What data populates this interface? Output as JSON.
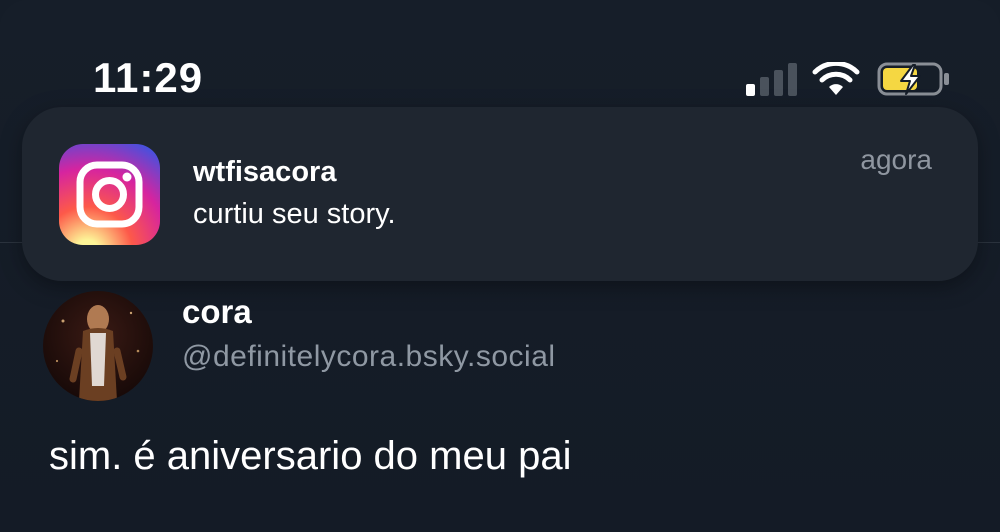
{
  "status_bar": {
    "time": "11:29",
    "icons": [
      "cellular-signal-icon",
      "wifi-icon",
      "battery-charging-icon"
    ],
    "battery_color": "#f5d742"
  },
  "notification": {
    "app_icon": "instagram-icon",
    "title": "wtfisacora",
    "body": "curtiu seu story.",
    "time": "agora"
  },
  "post": {
    "display_name": "cora",
    "handle": "@definitelycora.bsky.social",
    "text": "sim. é aniversario do meu pai"
  },
  "colors": {
    "background": "#151d28",
    "banner": "#1f2630",
    "secondary_text": "#8f98a3"
  }
}
